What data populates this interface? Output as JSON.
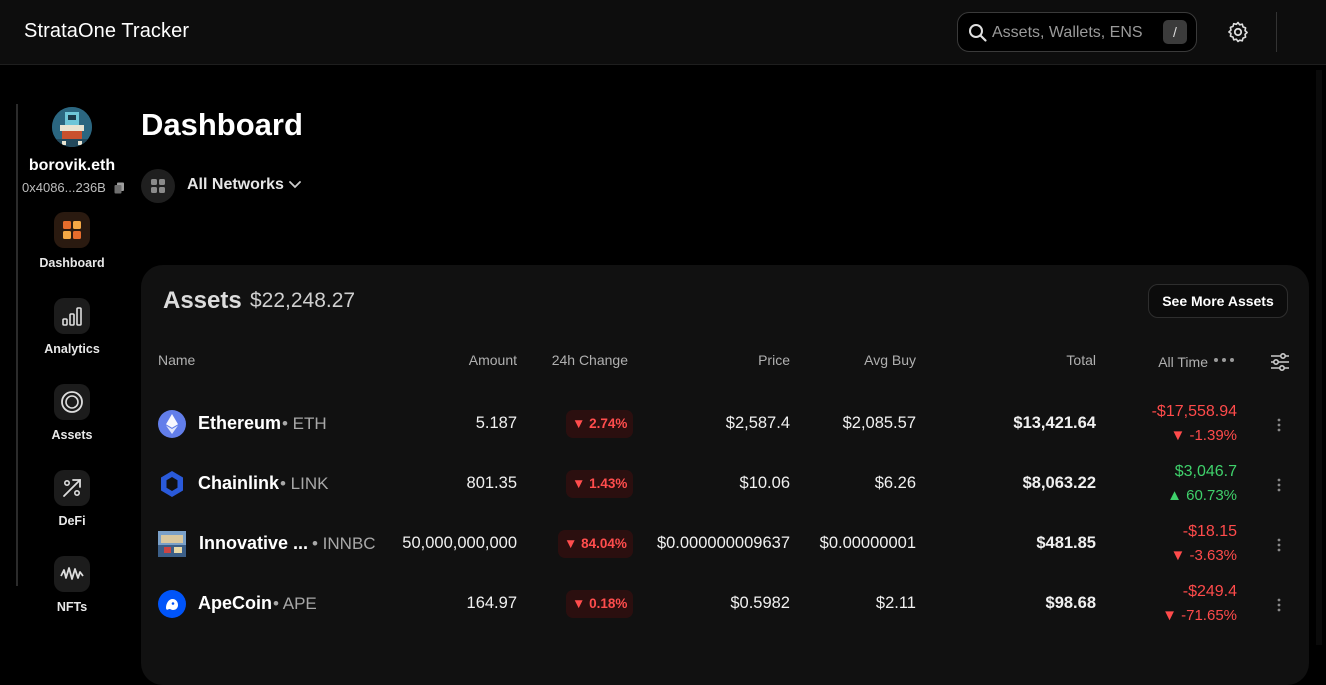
{
  "header": {
    "app_title": "StrataOne Tracker",
    "search_placeholder": "Assets, Wallets, ENS",
    "search_shortcut": "/"
  },
  "profile": {
    "ens": "borovik.eth",
    "address": "0x4086...236B"
  },
  "sidebar": {
    "items": [
      {
        "label": "Dashboard",
        "icon": "dashboard-grid-icon",
        "active": true
      },
      {
        "label": "Analytics",
        "icon": "bar-chart-icon",
        "active": false
      },
      {
        "label": "Assets",
        "icon": "coin-icon",
        "active": false
      },
      {
        "label": "DeFi",
        "icon": "defi-icon",
        "active": false
      },
      {
        "label": "NFTs",
        "icon": "nft-wave-icon",
        "active": false
      }
    ]
  },
  "page": {
    "title": "Dashboard",
    "network_label": "All Networks"
  },
  "assets_card": {
    "title": "Assets",
    "total_value": "$22,248.27",
    "see_more_label": "See More Assets",
    "columns": {
      "name": "Name",
      "amount": "Amount",
      "change24h": "24h Change",
      "price": "Price",
      "avg_buy": "Avg Buy",
      "total": "Total",
      "all_time": "All Time"
    },
    "rows": [
      {
        "name": "Ethereum",
        "symbol": "• ETH",
        "amount": "5.187",
        "change": "▼ 2.74%",
        "price": "$2,587.4",
        "avg_buy": "$2,085.57",
        "total": "$13,421.64",
        "pl": "-$17,558.94",
        "pl_pct": "▼ -1.39%",
        "pl_dir": "neg",
        "icon": "ethereum-icon"
      },
      {
        "name": "Chainlink",
        "symbol": "• LINK",
        "amount": "801.35",
        "change": "▼ 1.43%",
        "price": "$10.06",
        "avg_buy": "$6.26",
        "total": "$8,063.22",
        "pl": "$3,046.7",
        "pl_pct": "▲ 60.73%",
        "pl_dir": "pos",
        "icon": "chainlink-icon"
      },
      {
        "name": "Innovative ...",
        "symbol": "• INNBC",
        "amount": "50,000,000,000",
        "change": "▼ 84.04%",
        "price": "$0.000000009637",
        "avg_buy": "$0.00000001",
        "total": "$481.85",
        "pl": "-$18.15",
        "pl_pct": "▼ -3.63%",
        "pl_dir": "neg",
        "icon": "innbc-icon"
      },
      {
        "name": "ApeCoin",
        "symbol": "• APE",
        "amount": "164.97",
        "change": "▼ 0.18%",
        "price": "$0.5982",
        "avg_buy": "$2.11",
        "total": "$98.68",
        "pl": "-$249.4",
        "pl_pct": "▼ -71.65%",
        "pl_dir": "neg",
        "icon": "apecoin-icon"
      }
    ]
  },
  "colors": {
    "negative": "#ff4b4b",
    "positive": "#3fd16b",
    "accent": "#f08a2c"
  }
}
